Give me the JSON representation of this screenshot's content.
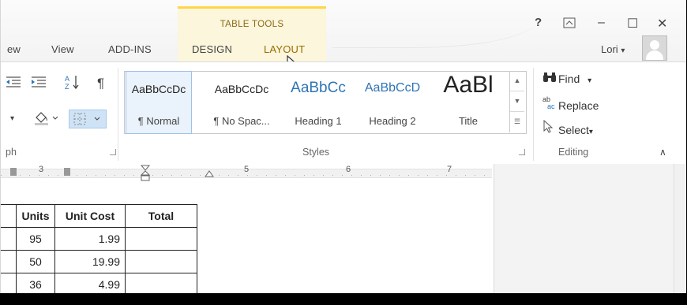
{
  "ribbon_tabs": {
    "partial": "ew",
    "view": "View",
    "addins": "ADD-INS",
    "design": "DESIGN",
    "layout": "LAYOUT"
  },
  "context": {
    "title": "TABLE TOOLS"
  },
  "window": {
    "help": "?",
    "ribbon_display": "⊼",
    "minimize": "–",
    "maximize": "☐",
    "close": "✕"
  },
  "account": {
    "user": "Lori",
    "caret": "▾"
  },
  "paragraph": {
    "label": "ph",
    "sort_icon": "↓",
    "pilcrow": "¶"
  },
  "styles": {
    "label": "Styles",
    "items": [
      {
        "preview": "AaBbCcDc",
        "name": "¶ Normal"
      },
      {
        "preview": "AaBbCcDc",
        "name": "¶ No Spac..."
      },
      {
        "preview": "AaBbCc",
        "name": "Heading 1"
      },
      {
        "preview": "AaBbCcD",
        "name": "Heading 2"
      },
      {
        "preview": "AaBl",
        "name": "Title"
      }
    ]
  },
  "editing": {
    "label": "Editing",
    "find": "Find",
    "find_caret": "▾",
    "replace": "Replace",
    "select": "Select",
    "select_caret": "▾"
  },
  "ruler": {
    "n3": "3",
    "n5": "5",
    "n6": "6",
    "n7": "7"
  },
  "table": {
    "headers": [
      "Units",
      "Unit Cost",
      "Total"
    ],
    "rows": [
      [
        "95",
        "1.99",
        ""
      ],
      [
        "50",
        "19.99",
        ""
      ],
      [
        "36",
        "4.99",
        ""
      ]
    ]
  },
  "colors": {
    "accent_tab": "#9a6c00",
    "context_bg": "#fbf6dc",
    "context_border": "#ffd54a",
    "heading_blue": "#2e74b5"
  }
}
